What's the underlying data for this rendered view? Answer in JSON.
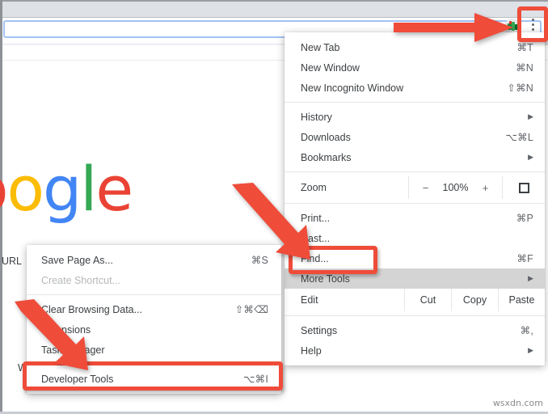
{
  "browser": {
    "omnibox_value": "",
    "menu_button": "chrome-menu-button",
    "extension_icon": "extension-icon"
  },
  "page_content": {
    "logo_letters": [
      "o",
      "o",
      "g",
      "l",
      "e"
    ],
    "url_label": "URL",
    "w_label": "W"
  },
  "main_menu": {
    "items": [
      {
        "label": "New Tab",
        "accelerator": "⌘T",
        "submenu": false
      },
      {
        "label": "New Window",
        "accelerator": "⌘N",
        "submenu": false
      },
      {
        "label": "New Incognito Window",
        "accelerator": "⇧⌘N",
        "submenu": false
      },
      {
        "label": "History",
        "accelerator": "",
        "submenu": true
      },
      {
        "label": "Downloads",
        "accelerator": "⌥⌘L",
        "submenu": false
      },
      {
        "label": "Bookmarks",
        "accelerator": "",
        "submenu": true
      },
      {
        "label": "Print...",
        "accelerator": "⌘P",
        "submenu": false
      },
      {
        "label": "Cast...",
        "accelerator": "",
        "submenu": false
      },
      {
        "label": "Find...",
        "accelerator": "⌘F",
        "submenu": false
      },
      {
        "label": "More Tools",
        "accelerator": "",
        "submenu": true,
        "highlighted": true
      },
      {
        "label": "Settings",
        "accelerator": "⌘,",
        "submenu": false
      },
      {
        "label": "Help",
        "accelerator": "",
        "submenu": true
      }
    ],
    "zoom_row": {
      "label": "Zoom",
      "minus": "−",
      "value": "100%",
      "plus": "+",
      "fullscreen_icon": "fullscreen-icon"
    },
    "edit_row": {
      "label": "Edit",
      "buttons": [
        "Cut",
        "Copy",
        "Paste"
      ]
    },
    "submenu_caret": "▶"
  },
  "more_tools_submenu": {
    "items": [
      {
        "label": "Save Page As...",
        "accelerator": "⌘S",
        "disabled": false
      },
      {
        "label": "Create Shortcut...",
        "accelerator": "",
        "disabled": true
      },
      {
        "label": "Clear Browsing Data...",
        "accelerator": "⇧⌘⌫",
        "disabled": false
      },
      {
        "label": "Extensions",
        "accelerator": "",
        "disabled": false
      },
      {
        "label": "Task Manager",
        "accelerator": "",
        "disabled": false
      },
      {
        "label": "Developer Tools",
        "accelerator": "⌥⌘I",
        "disabled": false
      }
    ]
  },
  "annotations": {
    "color": "#ef4c3a",
    "boxes": [
      "menu-button-highlight",
      "more-tools-highlight",
      "developer-tools-highlight"
    ],
    "arrows": [
      "arrow-to-menu-button",
      "arrow-to-more-tools",
      "arrow-to-developer-tools"
    ]
  },
  "watermark": {
    "text": "wsxdn.com"
  }
}
